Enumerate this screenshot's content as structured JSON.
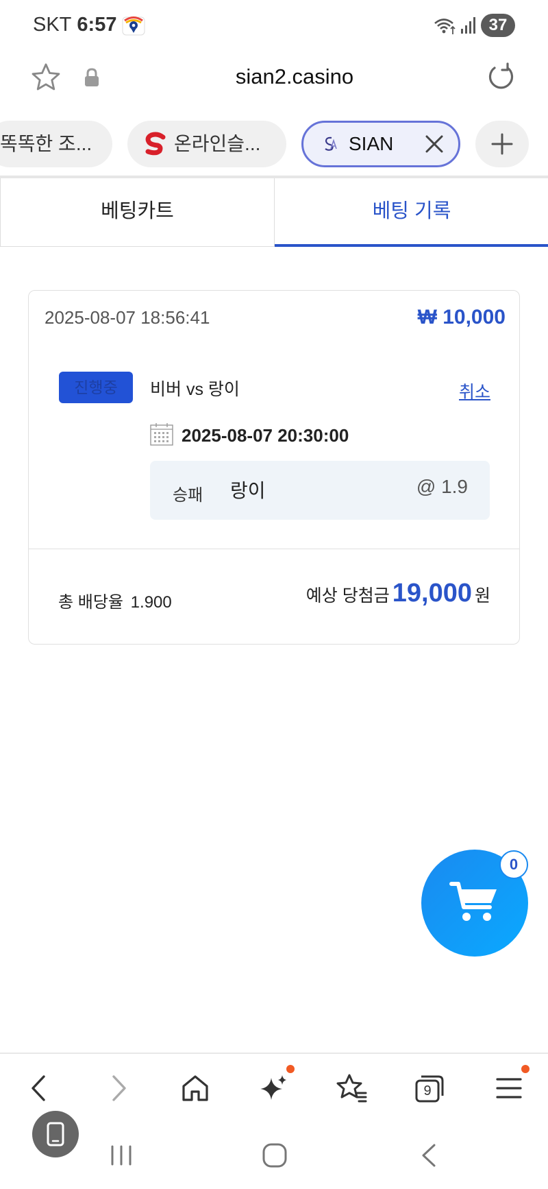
{
  "status_bar": {
    "carrier": "SKT",
    "time": "6:57",
    "battery": "37",
    "icons": [
      "location-map-icon",
      "wifi-icon",
      "signal-icon",
      "battery-icon"
    ]
  },
  "url_bar": {
    "url": "sian2.casino",
    "icons": [
      "star-icon",
      "lock-icon",
      "reload-icon"
    ]
  },
  "tabs": [
    {
      "label": "똑똑한 조...",
      "active": false
    },
    {
      "label": "온라인슬...",
      "active": false,
      "icon": "s-logo-icon"
    },
    {
      "label": "SIAN",
      "active": true,
      "icon": "sian-logo-icon"
    }
  ],
  "bet_tabs": {
    "cart": "베팅카트",
    "history": "베팅 기록",
    "active": "history"
  },
  "bet_card": {
    "datetime": "2025-08-07 18:56:41",
    "amount": "₩ 10,000",
    "status": "진행중",
    "match": "비버 vs 랑이",
    "cancel_label": "취소",
    "match_time": "2025-08-07 20:30:00",
    "pick": {
      "market": "승패",
      "selection": "랑이",
      "odds": "@ 1.9"
    },
    "total_odds_label": "총 배당율",
    "total_odds_value": "1.900",
    "payout_label": "예상 당첨금",
    "payout_value": "19,000",
    "payout_unit": "원"
  },
  "cart": {
    "count": "0"
  },
  "bottom_toolbar": {
    "tab_count": "9",
    "buttons": [
      "back-icon",
      "forward-icon",
      "home-icon",
      "ai-sparkle-icon",
      "bookmarks-icon",
      "tabs-icon",
      "menu-icon"
    ]
  },
  "colors": {
    "accent": "#2a54c9",
    "badge": "#2252d6",
    "tab_border": "#6673d8",
    "cart_fab": "#1a8af0",
    "notification_dot": "#f15a24"
  }
}
